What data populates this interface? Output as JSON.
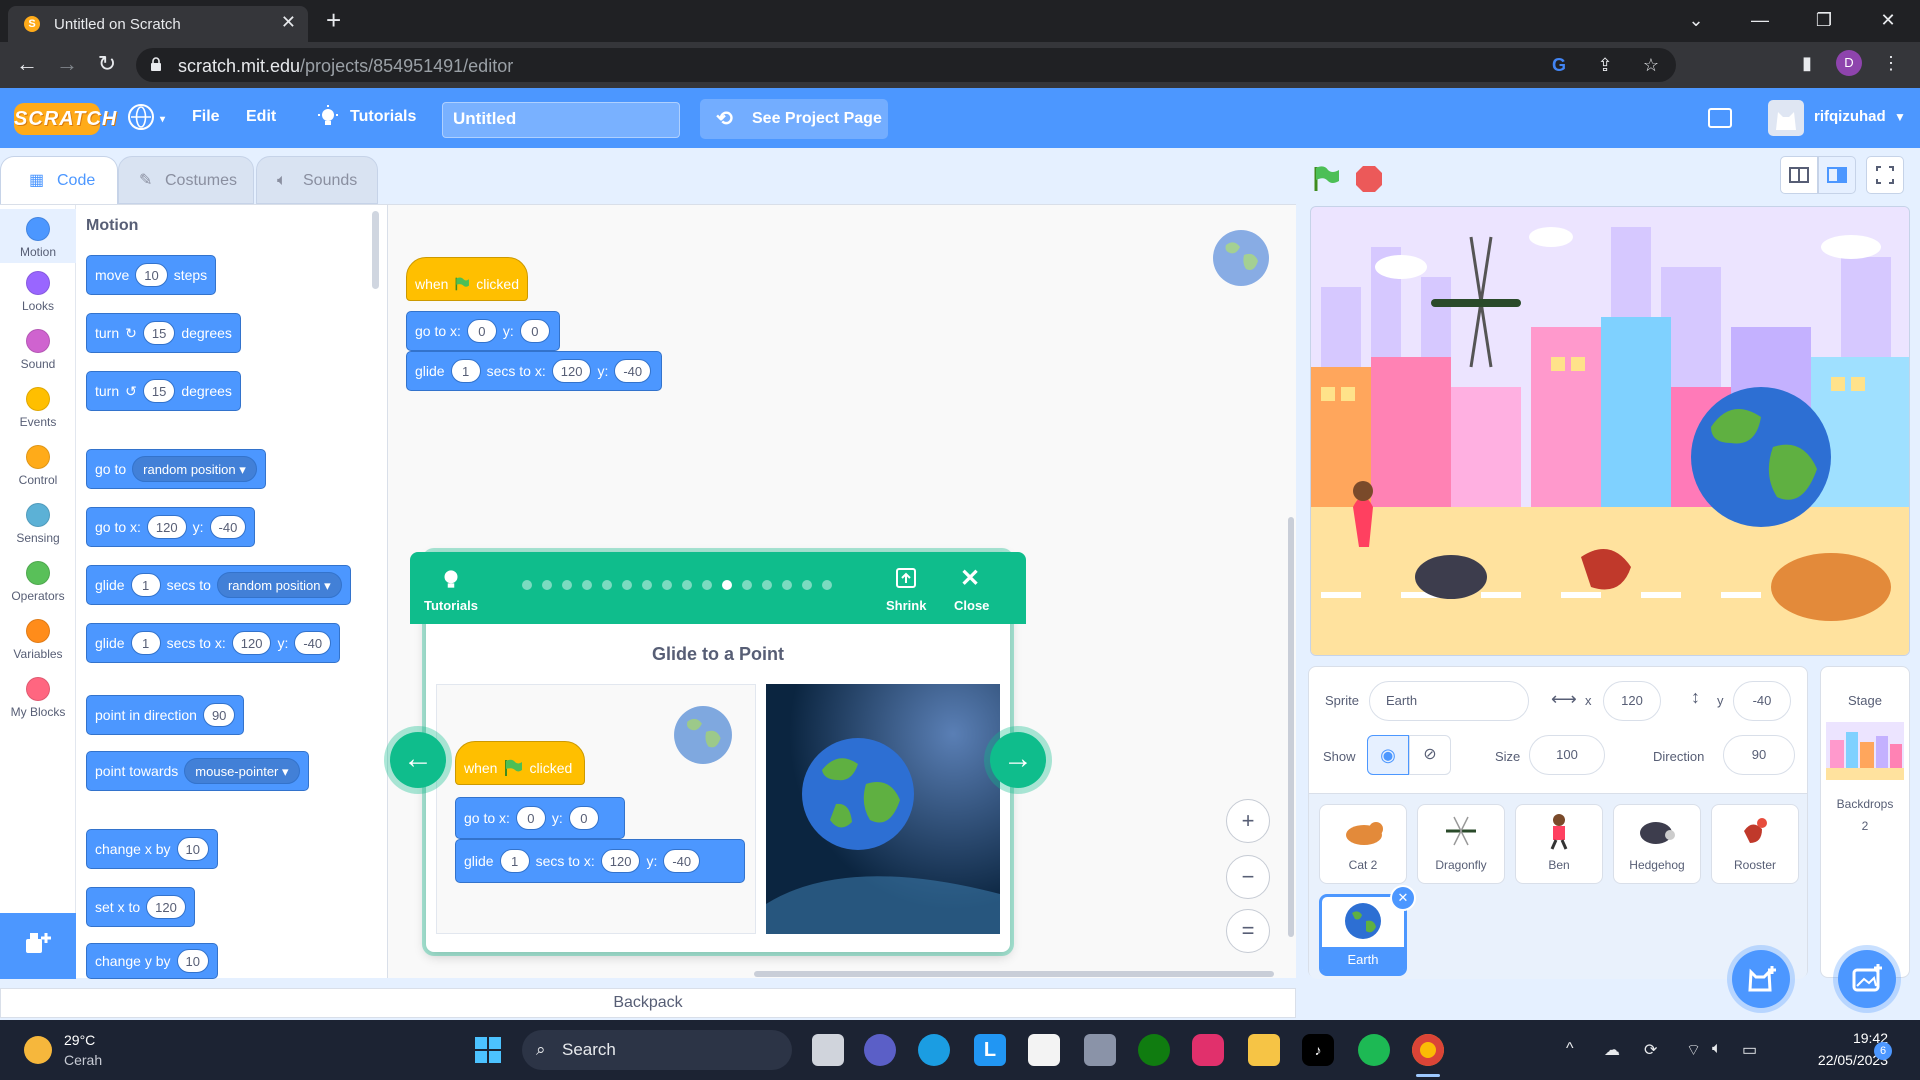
{
  "browser": {
    "tab_title": "Untitled on Scratch",
    "url_host": "scratch.mit.edu",
    "url_path": "/projects/854951491/editor",
    "profile_letter": "D"
  },
  "menubar": {
    "logo": "SCRATCH",
    "file": "File",
    "edit": "Edit",
    "tutorials": "Tutorials",
    "project_title": "Untitled",
    "see_project_page": "See Project Page",
    "username": "rifqizuhad"
  },
  "editor_tabs": {
    "code": "Code",
    "costumes": "Costumes",
    "sounds": "Sounds"
  },
  "categories": [
    {
      "label": "Motion",
      "color": "#4c97ff"
    },
    {
      "label": "Looks",
      "color": "#9966ff"
    },
    {
      "label": "Sound",
      "color": "#cf63cf"
    },
    {
      "label": "Events",
      "color": "#ffbf00"
    },
    {
      "label": "Control",
      "color": "#ffab19"
    },
    {
      "label": "Sensing",
      "color": "#5cb1d6"
    },
    {
      "label": "Operators",
      "color": "#59c059"
    },
    {
      "label": "Variables",
      "color": "#ff8c1a"
    },
    {
      "label": "My Blocks",
      "color": "#ff6680"
    }
  ],
  "palette": {
    "heading": "Motion",
    "move": {
      "a": "move",
      "v": "10",
      "b": "steps"
    },
    "turn_right": {
      "a": "turn",
      "v": "15",
      "b": "degrees"
    },
    "turn_left": {
      "a": "turn",
      "v": "15",
      "b": "degrees"
    },
    "goto": {
      "a": "go to",
      "d": "random position"
    },
    "goto_xy": {
      "a": "go to x:",
      "x": "120",
      "b": "y:",
      "y": "-40"
    },
    "glide_to": {
      "a": "glide",
      "v": "1",
      "b": "secs to",
      "d": "random position"
    },
    "glide_xy": {
      "a": "glide",
      "v": "1",
      "b": "secs to x:",
      "x": "120",
      "c": "y:",
      "y": "-40"
    },
    "point_dir": {
      "a": "point in direction",
      "v": "90"
    },
    "point_towards": {
      "a": "point towards",
      "d": "mouse-pointer"
    },
    "change_x": {
      "a": "change x by",
      "v": "10"
    },
    "set_x": {
      "a": "set x to",
      "v": "120"
    },
    "change_y": {
      "a": "change y by",
      "v": "10"
    }
  },
  "script": {
    "hat_when": "when",
    "hat_clicked": "clicked",
    "goto_a": "go to x:",
    "goto_x": "0",
    "goto_b": "y:",
    "goto_y": "0",
    "glide_a": "glide",
    "glide_v": "1",
    "glide_b": "secs to x:",
    "glide_x": "120",
    "glide_c": "y:",
    "glide_y": "-40"
  },
  "zoom": {
    "in": "+",
    "out": "−",
    "reset": "="
  },
  "tutorial": {
    "tutorials_label": "Tutorials",
    "shrink_label": "Shrink",
    "close_label": "Close",
    "title": "Glide to a Point",
    "total_steps": 16,
    "current_step": 11
  },
  "sprite_info": {
    "sprite_label": "Sprite",
    "sprite_name": "Earth",
    "x_label": "x",
    "x": "120",
    "y_label": "y",
    "y": "-40",
    "show_label": "Show",
    "size_label": "Size",
    "size": "100",
    "direction_label": "Direction",
    "direction": "90"
  },
  "sprites": [
    {
      "name": "Cat 2"
    },
    {
      "name": "Dragonfly"
    },
    {
      "name": "Ben"
    },
    {
      "name": "Hedgehog"
    },
    {
      "name": "Rooster"
    },
    {
      "name": "Earth"
    }
  ],
  "stage_pane": {
    "title": "Stage",
    "backdrops_label": "Backdrops",
    "backdrops_count": "2"
  },
  "backpack": "Backpack",
  "taskbar": {
    "temp": "29°C",
    "condition": "Cerah",
    "search": "Search",
    "time": "19:42",
    "date": "22/05/2023",
    "notif": "6"
  }
}
